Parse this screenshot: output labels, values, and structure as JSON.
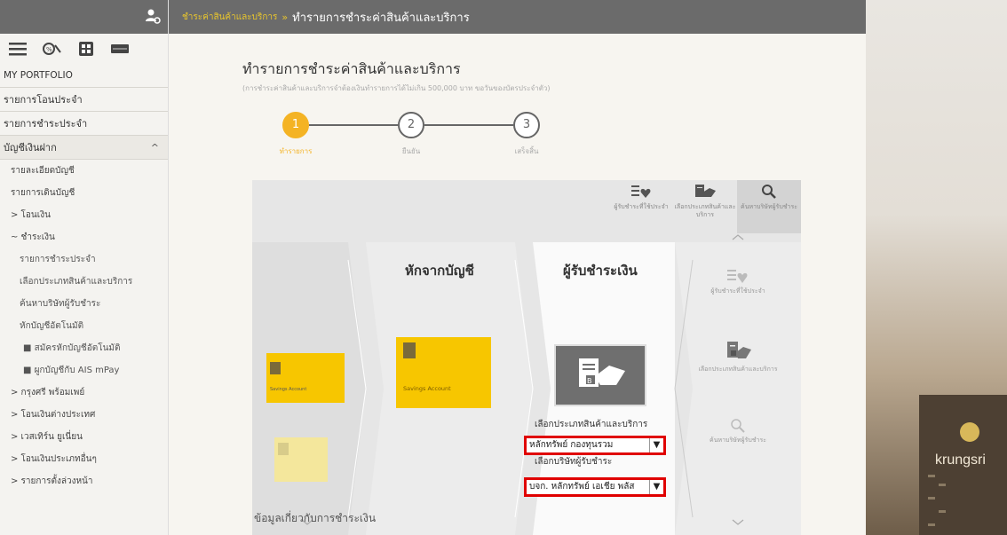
{
  "sidebar": {
    "portfolio": "MY PORTFOLIO",
    "items": [
      "รายการโอนประจำ",
      "รายการชำระประจำ"
    ],
    "accounts": {
      "label": "บัญชีเงินฝาก",
      "caret": "^",
      "children": [
        "รายละเอียดบัญชี",
        "รายการเดินบัญชี"
      ]
    },
    "transfer": "> โอนเงิน",
    "payment": {
      "label": "~ ชำระเงิน",
      "children": [
        "รายการชำระประจำ",
        "เลือกประเภทสินค้าและบริการ",
        "ค้นหาบริษัทผู้รับชำระ",
        "หักบัญชีอัตโนมัติ"
      ],
      "sub_children": [
        "สมัครหักบัญชีอัตโนมัติ",
        "ผูกบัญชีกับ AIS mPay"
      ]
    },
    "more": [
      "> กรุงศรี พร้อมเพย์",
      "> โอนเงินต่างประเทศ",
      "> เวสเทิร์น ยูเนี่ยน",
      "> โอนเงินประเภทอื่นๆ",
      "> รายการตั้งล่วงหน้า"
    ]
  },
  "topbar": {
    "crumb_parent": "ชำระค่าสินค้าและบริการ",
    "crumb_sep": "»",
    "crumb_current": "ทำรายการชำระค่าสินค้าและบริการ"
  },
  "main": {
    "title": "ทำรายการชำระค่าสินค้าและบริการ",
    "note": "(การชำระค่าสินค้าและบริการจำต้องเงินทำรายการได้ไม่เกิน 500,000 บาท ขอวันของบัตรประจำตัว)",
    "steps": [
      {
        "num": "1",
        "label": "ทำรายการ"
      },
      {
        "num": "2",
        "label": "ยืนยัน"
      },
      {
        "num": "3",
        "label": "เสร็จสิ้น"
      }
    ],
    "tools": [
      "ผู้รับชำระที่ใช้ประจำ",
      "เลือกประเภทสินค้าและบริการ",
      "ค้นหาบริษัทผู้รับชำระ"
    ],
    "from_title": "หักจากบัญชี",
    "to_title": "ผู้รับชำระเงิน",
    "card_small_label": "Savings Account",
    "card_main_label": "Savings Account",
    "field1_label": "เลือกประเภทสินค้าและบริการ",
    "field1_value": "หลักทรัพย์ กองทุนรวม",
    "field2_label": "เลือกบริษัทผู้รับชำระ",
    "field2_value": "บจก. หลักทรัพย์ เอเชีย พลัส",
    "right_items": [
      "ผู้รับชำระที่ใช้ประจำ",
      "เลือกประเภทสินค้าและบริการ",
      "ค้นหาบริษัทผู้รับชำระ"
    ],
    "bottom_info": "ข้อมูลเกี่ยวกับการชำระเงิน"
  },
  "banner": {
    "brand": "krungsri"
  },
  "colors": {
    "accent": "#f4b324",
    "card": "#f7c600",
    "highlight": "#e00000",
    "topbar": "#6b6b6b"
  }
}
